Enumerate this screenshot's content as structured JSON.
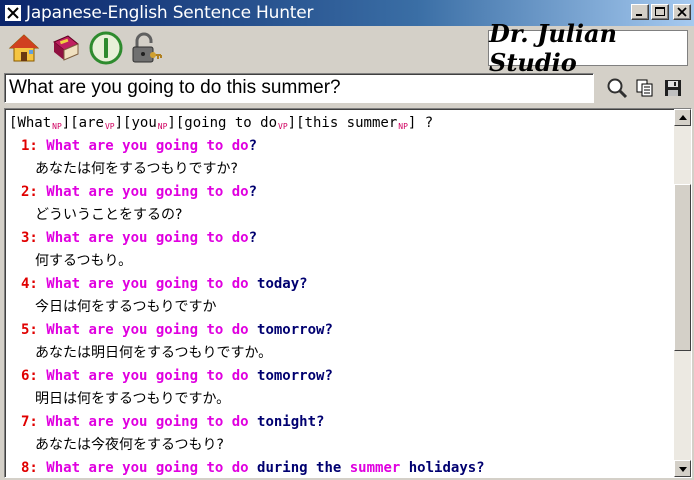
{
  "window": {
    "title": "Japanese-English Sentence Hunter",
    "buttons": [
      "minimize",
      "maximize",
      "close"
    ]
  },
  "toolbar": {
    "icons": [
      "home-icon",
      "dictionary-book-icon",
      "power-icon",
      "lock-icon"
    ],
    "logo_text": "Dr. Julian Studio"
  },
  "search": {
    "value": "What are you going to do this summer?",
    "actions": [
      "search-icon",
      "copy-icon",
      "save-icon"
    ]
  },
  "parse": {
    "phrases": [
      {
        "text": "What",
        "tag": "NP"
      },
      {
        "text": "are",
        "tag": "VP"
      },
      {
        "text": "you",
        "tag": "NP"
      },
      {
        "text": "going to do",
        "tag": "VP"
      },
      {
        "text": "this summer",
        "tag": "NP"
      }
    ],
    "end": "?"
  },
  "results": [
    {
      "num": "1:",
      "en": [
        {
          "t": "What are you going to do",
          "s": "hit"
        },
        {
          "t": "?",
          "s": "norm"
        }
      ],
      "ja": "あなたは何をするつもりですか?"
    },
    {
      "num": "2:",
      "en": [
        {
          "t": "What are you going to do",
          "s": "hit"
        },
        {
          "t": "?",
          "s": "norm"
        }
      ],
      "ja": "どういうことをするの?"
    },
    {
      "num": "3:",
      "en": [
        {
          "t": "What are you going to do",
          "s": "hit"
        },
        {
          "t": "?",
          "s": "norm"
        }
      ],
      "ja": "何するつもり。"
    },
    {
      "num": "4:",
      "en": [
        {
          "t": "What are you going to do",
          "s": "hit"
        },
        {
          "t": " today?",
          "s": "norm"
        }
      ],
      "ja": "今日は何をするつもりですか"
    },
    {
      "num": "5:",
      "en": [
        {
          "t": "What are you going to do",
          "s": "hit"
        },
        {
          "t": " tomorrow?",
          "s": "norm"
        }
      ],
      "ja": "あなたは明日何をするつもりですか。"
    },
    {
      "num": "6:",
      "en": [
        {
          "t": "What are you going to do",
          "s": "hit"
        },
        {
          "t": " tomorrow?",
          "s": "norm"
        }
      ],
      "ja": "明日は何をするつもりですか。"
    },
    {
      "num": "7:",
      "en": [
        {
          "t": "What are you going to do",
          "s": "hit"
        },
        {
          "t": " tonight?",
          "s": "norm"
        }
      ],
      "ja": "あなたは今夜何をするつもり?"
    },
    {
      "num": "8:",
      "en": [
        {
          "t": "What are you going to do",
          "s": "hit"
        },
        {
          "t": " during the ",
          "s": "norm"
        },
        {
          "t": "summer",
          "s": "hit"
        },
        {
          "t": " holidays?",
          "s": "norm"
        }
      ],
      "ja": ""
    }
  ],
  "scroll": {
    "position": 0.35,
    "visible_fraction": 0.5
  }
}
